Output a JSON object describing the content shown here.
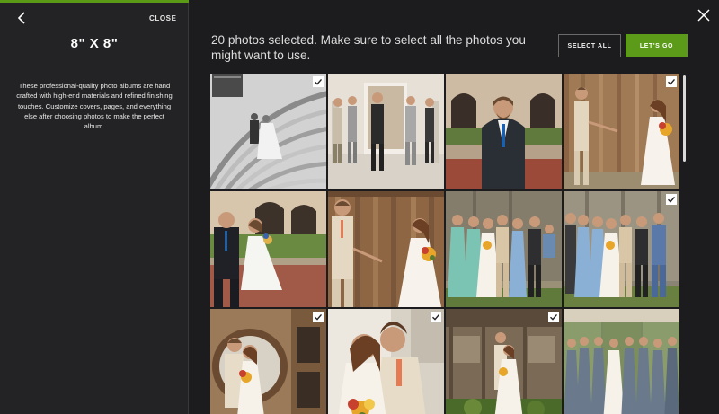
{
  "sidebar": {
    "close_label": "CLOSE",
    "title": "8\" X 8\"",
    "description": "These professional-quality photo albums are hand crafted with high-end materials and refined finishing touches. Customize covers, pages, and everything else after choosing photos to make the perfect album."
  },
  "header": {
    "message": "20 photos selected. Make sure to select all the photos you might want to use.",
    "select_all_label": "SELECT ALL",
    "lets_go_label": "LET'S GO"
  },
  "colors": {
    "accent_green": "#5c9a1a",
    "sidebar_bg": "#232325",
    "main_bg": "#1c1c1e"
  },
  "photos": [
    {
      "scene": "couple-on-staircase-bw",
      "selected": true
    },
    {
      "scene": "groomsmen-in-hall",
      "selected": false
    },
    {
      "scene": "groom-portrait-arches",
      "selected": false
    },
    {
      "scene": "couple-barn-door",
      "selected": true
    },
    {
      "scene": "couple-garden-arches",
      "selected": false
    },
    {
      "scene": "couple-barn-door-closeup",
      "selected": false
    },
    {
      "scene": "family-group-barn",
      "selected": false
    },
    {
      "scene": "family-group-barn-2",
      "selected": true
    },
    {
      "scene": "couple-round-window",
      "selected": true
    },
    {
      "scene": "couple-embrace-closeup",
      "selected": true
    },
    {
      "scene": "couple-wooden-shed",
      "selected": true
    },
    {
      "scene": "bridesmaids-green-doors",
      "selected": false
    }
  ]
}
